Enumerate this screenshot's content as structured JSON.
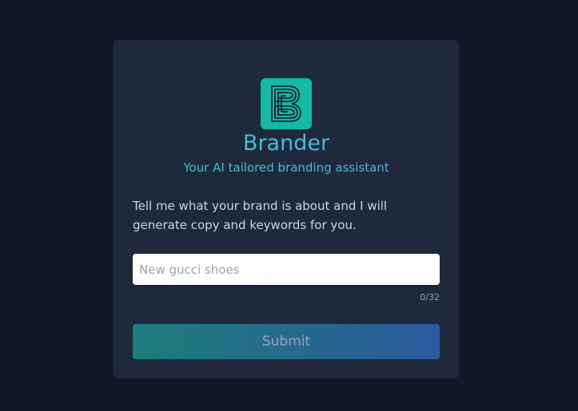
{
  "app": {
    "logo_icon": "brander-b-logo-icon",
    "name": "Brander",
    "tagline": "Your AI tailored branding assistant"
  },
  "form": {
    "prompt": "Tell me what your brand is about and I will generate copy and keywords for you.",
    "input_value": "",
    "input_placeholder": "New gucci shoes",
    "char_counter": "0/32",
    "submit_label": "Submit"
  },
  "colors": {
    "background": "#111827",
    "card": "#1e293b",
    "logo_bg": "#14b8a6",
    "accent_teal": "#2dd4bf",
    "accent_blue": "#60a5fa"
  }
}
